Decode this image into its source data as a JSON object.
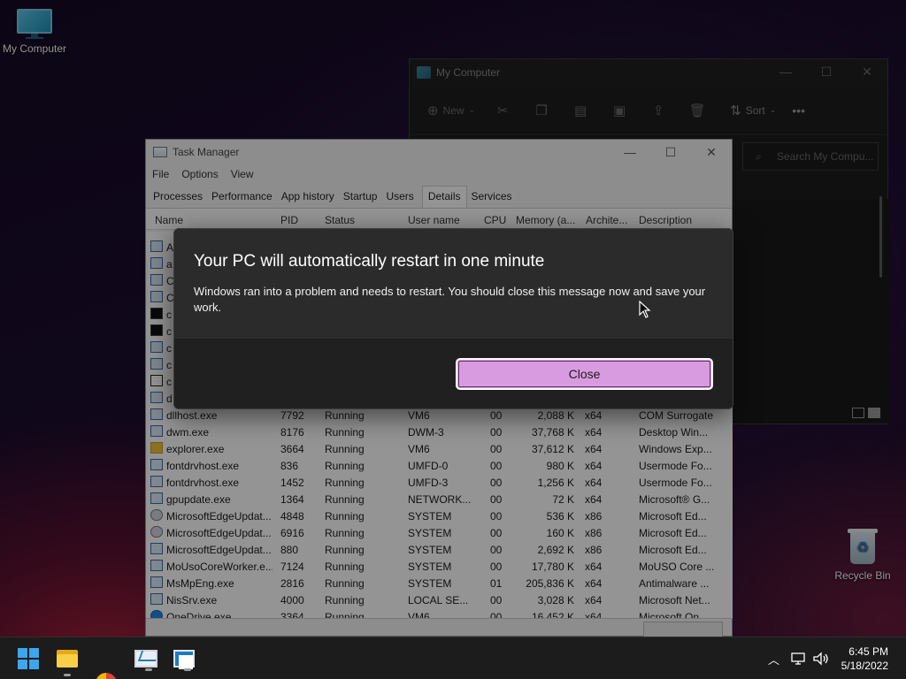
{
  "desktop": {
    "icons": [
      {
        "label": "My Computer"
      },
      {
        "label": "Recycle Bin"
      }
    ]
  },
  "explorer": {
    "title": "My Computer",
    "toolbar": {
      "new_label": "New",
      "sort_label": "Sort",
      "more_label": "•••"
    },
    "search_placeholder": "Search My Compu..."
  },
  "taskmanager": {
    "title": "Task Manager",
    "menu": [
      "File",
      "Options",
      "View"
    ],
    "tabs": [
      "Processes",
      "Performance",
      "App history",
      "Startup",
      "Users",
      "Details",
      "Services"
    ],
    "active_tab": "Details",
    "columns": [
      "Name",
      "PID",
      "Status",
      "User name",
      "CPU",
      "Memory (a...",
      "Archite...",
      "Description"
    ],
    "rows": [
      {
        "name": "A",
        "pid": "",
        "status": "",
        "user": "",
        "cpu": "",
        "mem": "",
        "arch": "",
        "desc": "",
        "icon": "app"
      },
      {
        "name": "a",
        "pid": "",
        "status": "",
        "user": "",
        "cpu": "",
        "mem": "",
        "arch": "",
        "desc": "",
        "icon": "app"
      },
      {
        "name": "C",
        "pid": "",
        "status": "",
        "user": "",
        "cpu": "",
        "mem": "",
        "arch": "",
        "desc": "",
        "icon": "app"
      },
      {
        "name": "C",
        "pid": "",
        "status": "",
        "user": "",
        "cpu": "",
        "mem": "",
        "arch": "",
        "desc": "",
        "icon": "app"
      },
      {
        "name": "c",
        "pid": "",
        "status": "",
        "user": "",
        "cpu": "",
        "mem": "",
        "arch": "",
        "desc": "",
        "icon": "cmd"
      },
      {
        "name": "c",
        "pid": "",
        "status": "",
        "user": "",
        "cpu": "",
        "mem": "",
        "arch": "",
        "desc": "",
        "icon": "cmd"
      },
      {
        "name": "c",
        "pid": "",
        "status": "",
        "user": "",
        "cpu": "",
        "mem": "",
        "arch": "",
        "desc": "",
        "icon": "app"
      },
      {
        "name": "c",
        "pid": "",
        "status": "",
        "user": "",
        "cpu": "",
        "mem": "",
        "arch": "",
        "desc": "",
        "icon": "app"
      },
      {
        "name": "c",
        "pid": "",
        "status": "",
        "user": "",
        "cpu": "",
        "mem": "",
        "arch": "",
        "desc": "",
        "icon": "note"
      },
      {
        "name": "d",
        "pid": "",
        "status": "",
        "user": "",
        "cpu": "",
        "mem": "",
        "arch": "",
        "desc": "",
        "icon": "app"
      },
      {
        "name": "dllhost.exe",
        "pid": "7792",
        "status": "Running",
        "user": "VM6",
        "cpu": "00",
        "mem": "2,088 K",
        "arch": "x64",
        "desc": "COM Surrogate",
        "icon": "app"
      },
      {
        "name": "dwm.exe",
        "pid": "8176",
        "status": "Running",
        "user": "DWM-3",
        "cpu": "00",
        "mem": "37,768 K",
        "arch": "x64",
        "desc": "Desktop Win...",
        "icon": "app"
      },
      {
        "name": "explorer.exe",
        "pid": "3664",
        "status": "Running",
        "user": "VM6",
        "cpu": "00",
        "mem": "37,612 K",
        "arch": "x64",
        "desc": "Windows Exp...",
        "icon": "folder"
      },
      {
        "name": "fontdrvhost.exe",
        "pid": "836",
        "status": "Running",
        "user": "UMFD-0",
        "cpu": "00",
        "mem": "980 K",
        "arch": "x64",
        "desc": "Usermode Fo...",
        "icon": "app"
      },
      {
        "name": "fontdrvhost.exe",
        "pid": "1452",
        "status": "Running",
        "user": "UMFD-3",
        "cpu": "00",
        "mem": "1,256 K",
        "arch": "x64",
        "desc": "Usermode Fo...",
        "icon": "app"
      },
      {
        "name": "gpupdate.exe",
        "pid": "1364",
        "status": "Running",
        "user": "NETWORK...",
        "cpu": "00",
        "mem": "72 K",
        "arch": "x64",
        "desc": "Microsoft® G...",
        "icon": "app"
      },
      {
        "name": "MicrosoftEdgeUpdat...",
        "pid": "4848",
        "status": "Running",
        "user": "SYSTEM",
        "cpu": "00",
        "mem": "536 K",
        "arch": "x86",
        "desc": "Microsoft Ed...",
        "icon": "edge"
      },
      {
        "name": "MicrosoftEdgeUpdat...",
        "pid": "6916",
        "status": "Running",
        "user": "SYSTEM",
        "cpu": "00",
        "mem": "160 K",
        "arch": "x86",
        "desc": "Microsoft Ed...",
        "icon": "edge"
      },
      {
        "name": "MicrosoftEdgeUpdat...",
        "pid": "880",
        "status": "Running",
        "user": "SYSTEM",
        "cpu": "00",
        "mem": "2,692 K",
        "arch": "x86",
        "desc": "Microsoft Ed...",
        "icon": "app"
      },
      {
        "name": "MoUsoCoreWorker.e...",
        "pid": "7124",
        "status": "Running",
        "user": "SYSTEM",
        "cpu": "00",
        "mem": "17,780 K",
        "arch": "x64",
        "desc": "MoUSO Core ...",
        "icon": "app"
      },
      {
        "name": "MsMpEng.exe",
        "pid": "2816",
        "status": "Running",
        "user": "SYSTEM",
        "cpu": "01",
        "mem": "205,836 K",
        "arch": "x64",
        "desc": "Antimalware ...",
        "icon": "app"
      },
      {
        "name": "NisSrv.exe",
        "pid": "4000",
        "status": "Running",
        "user": "LOCAL SE...",
        "cpu": "00",
        "mem": "3,028 K",
        "arch": "x64",
        "desc": "Microsoft Net...",
        "icon": "app"
      },
      {
        "name": "OneDrive.exe",
        "pid": "3364",
        "status": "Running",
        "user": "VM6",
        "cpu": "00",
        "mem": "16,452 K",
        "arch": "x64",
        "desc": "Microsoft On...",
        "icon": "cloud"
      }
    ]
  },
  "dialog": {
    "title": "Your PC will automatically restart in one minute",
    "message": "Windows ran into a problem and needs to restart. You should close this message now and save your work.",
    "close_label": "Close",
    "accent_color": "#d99be0"
  },
  "taskbar": {
    "apps": [
      "start-icon",
      "file-explorer-icon",
      "chrome-icon",
      "task-manager-icon",
      "app-icon"
    ],
    "time": "6:45 PM",
    "date": "5/18/2022"
  }
}
